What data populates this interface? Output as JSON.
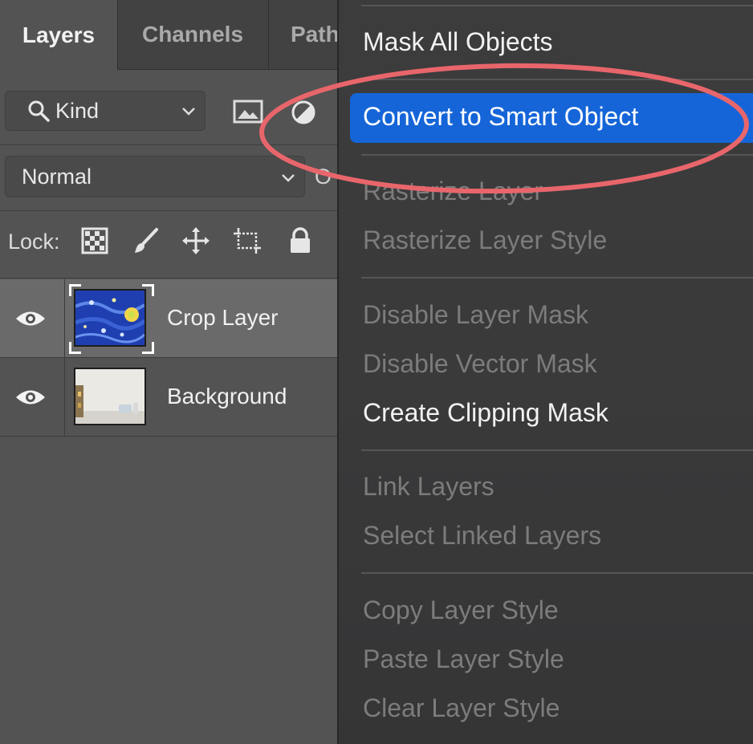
{
  "tabs": [
    {
      "label": "Layers",
      "active": true
    },
    {
      "label": "Channels",
      "active": false
    },
    {
      "label": "Path",
      "active": false
    }
  ],
  "filter": {
    "kind_label": "Kind",
    "icons": [
      "search-icon",
      "image-filter-icon",
      "adjustment-filter-icon",
      "chevron-down-icon"
    ]
  },
  "blend": {
    "mode_label": "Normal",
    "opacity_label_partial": "O"
  },
  "lock": {
    "label": "Lock:",
    "icons": [
      "lock-transparent-icon",
      "lock-paint-icon",
      "lock-position-icon",
      "lock-artboard-icon",
      "lock-all-icon"
    ]
  },
  "layers": [
    {
      "name": "Crop Layer",
      "selected": true,
      "thumbnail": "starry-night-pattern"
    },
    {
      "name": "Background",
      "selected": false,
      "thumbnail": "room-interior"
    }
  ],
  "context_menu": {
    "items": [
      {
        "label": "Mask All Objects",
        "state": "enabled"
      },
      {
        "label": "Convert to Smart Object",
        "state": "highlighted"
      },
      {
        "label": "Rasterize Layer",
        "state": "disabled"
      },
      {
        "label": "Rasterize Layer Style",
        "state": "disabled"
      },
      {
        "label": "Disable Layer Mask",
        "state": "disabled"
      },
      {
        "label": "Disable Vector Mask",
        "state": "disabled"
      },
      {
        "label": "Create Clipping Mask",
        "state": "enabled"
      },
      {
        "label": "Link Layers",
        "state": "disabled"
      },
      {
        "label": "Select Linked Layers",
        "state": "disabled"
      },
      {
        "label": "Copy Layer Style",
        "state": "disabled"
      },
      {
        "label": "Paste Layer Style",
        "state": "disabled"
      },
      {
        "label": "Clear Layer Style",
        "state": "disabled"
      }
    ]
  },
  "colors": {
    "panel_bg": "#535353",
    "menu_bg": "#3a3a3b",
    "highlight": "#1565d8",
    "annotation_circle": "#e8666b",
    "disabled_text": "#7c7c7c"
  }
}
